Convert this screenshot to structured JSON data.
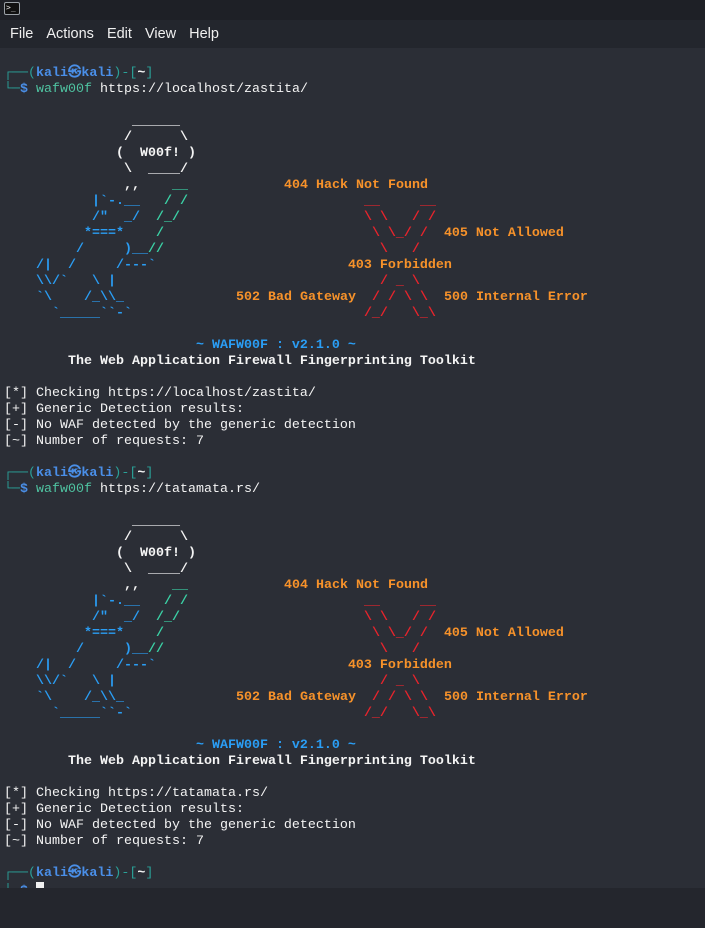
{
  "window": {
    "icon": "terminal-icon"
  },
  "menu": [
    "File",
    "Actions",
    "Edit",
    "View",
    "Help"
  ],
  "colors": {
    "background": "#2b2e36",
    "prompt_box": "#2aa198",
    "prompt_user": "#4a8fe8",
    "command": "#4fc3a1",
    "ascii_blue": "#2a9df4",
    "ascii_teal": "#3bd1a6",
    "status_orange": "#f7922a",
    "x_red": "#e8242c"
  },
  "prompt": {
    "box_top": "┌──(",
    "user": "kali㉿kali",
    "mid": ")-[",
    "dir": "~",
    "end": "]",
    "box_bottom": "└─",
    "symbol": "$"
  },
  "banner": [
    [
      [
        "                ______",
        "white"
      ]
    ],
    [
      [
        "               /      \\",
        "white"
      ]
    ],
    [
      [
        "              (  W00f! )",
        "white"
      ]
    ],
    [
      [
        "               \\  ____/",
        "white"
      ]
    ],
    [
      [
        "               ,,",
        "white"
      ],
      [
        "    __",
        "teal"
      ],
      [
        "            "
      ],
      [
        "404 Hack Not Found",
        "orange"
      ]
    ],
    [
      [
        "           |`-.__",
        "blue"
      ],
      [
        "   / /",
        "teal"
      ],
      [
        "                      "
      ],
      [
        "__     __",
        "red"
      ]
    ],
    [
      [
        "           /\"  _/",
        "blue"
      ],
      [
        "  /_/",
        "teal"
      ],
      [
        "                       "
      ],
      [
        "\\ \\   / /",
        "red"
      ]
    ],
    [
      [
        "          *===*",
        "blue"
      ],
      [
        "    /",
        "teal"
      ],
      [
        "                          "
      ],
      [
        "\\ \\_/ /",
        "red"
      ],
      [
        "  "
      ],
      [
        "405 Not Allowed",
        "orange"
      ]
    ],
    [
      [
        "         /     )__",
        "blue"
      ],
      [
        "//",
        "teal"
      ],
      [
        "                           "
      ],
      [
        "\\   /",
        "red"
      ]
    ],
    [
      [
        "    /|  /     /---`",
        "blue"
      ],
      [
        "                        "
      ],
      [
        "403 Forbidden",
        "orange"
      ]
    ],
    [
      [
        "    \\\\/`   \\ |",
        "blue"
      ],
      [
        "                                 "
      ],
      [
        "/ _ \\",
        "red"
      ]
    ],
    [
      [
        "    `\\    /_\\\\_",
        "blue"
      ],
      [
        "              "
      ],
      [
        "502 Bad Gateway",
        "orange"
      ],
      [
        "  "
      ],
      [
        "/ / \\ \\",
        "red"
      ],
      [
        "  "
      ],
      [
        "500 Internal Error",
        "orange"
      ]
    ],
    [
      [
        "      `_____``-`",
        "blue"
      ],
      [
        "                             "
      ],
      [
        "/_/   \\_\\",
        "red"
      ]
    ],
    [],
    [
      [
        "                        ~ WAFW00F : v2.1.0 ~",
        "blue"
      ]
    ],
    [
      [
        "        The Web Application Firewall Fingerprinting Toolkit",
        "white"
      ]
    ]
  ],
  "sessions": [
    {
      "command": "wafw00f",
      "url": "https://localhost/zastita/",
      "output": [
        "[*] Checking https://localhost/zastita/",
        "[+] Generic Detection results:",
        "[-] No WAF detected by the generic detection",
        "[~] Number of requests: 7"
      ]
    },
    {
      "command": "wafw00f",
      "url": "https://tatamata.rs/",
      "output": [
        "[*] Checking https://tatamata.rs/",
        "[+] Generic Detection results:",
        "[-] No WAF detected by the generic detection",
        "[~] Number of requests: 7"
      ]
    }
  ]
}
